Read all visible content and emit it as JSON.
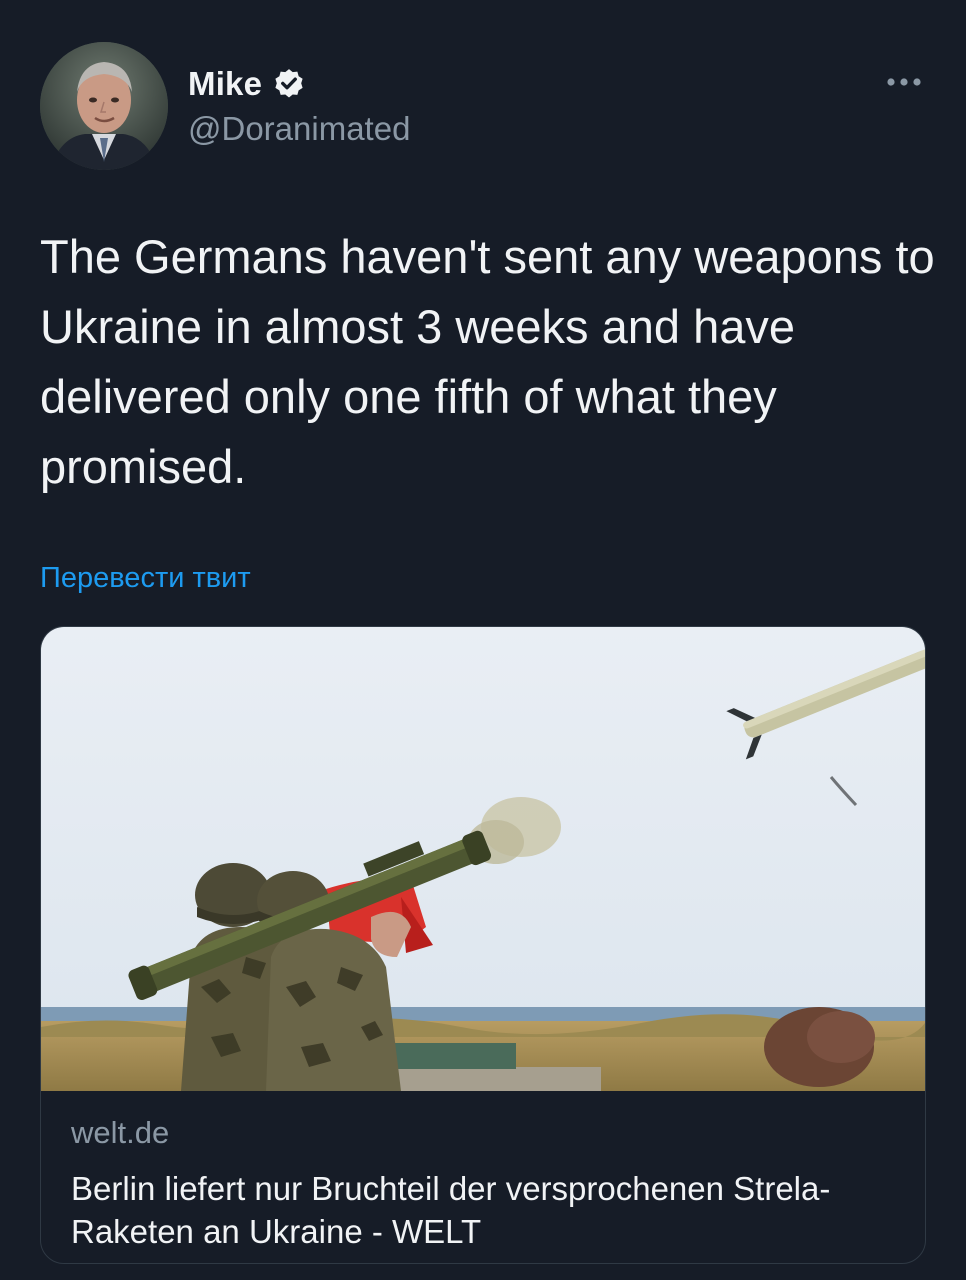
{
  "author": {
    "display_name": "Mike",
    "handle": "@Doranimated",
    "verified": true
  },
  "tweet": {
    "text": "The Germans haven't sent any weapons to Ukraine in almost 3 weeks and have delivered only one fifth of what they promised.",
    "translate_label": "Перевести твит"
  },
  "card": {
    "domain": "welt.de",
    "title": "Berlin liefert nur Bruchteil der versprochenen Strela-Raketen an Ukraine - WELT"
  },
  "colors": {
    "background": "#161c27",
    "accent": "#1d9bf0",
    "text_primary": "#f1f3f5",
    "text_secondary": "#8b98a5"
  },
  "icons": {
    "verified": "verified-badge-icon",
    "more": "more-options-icon"
  }
}
